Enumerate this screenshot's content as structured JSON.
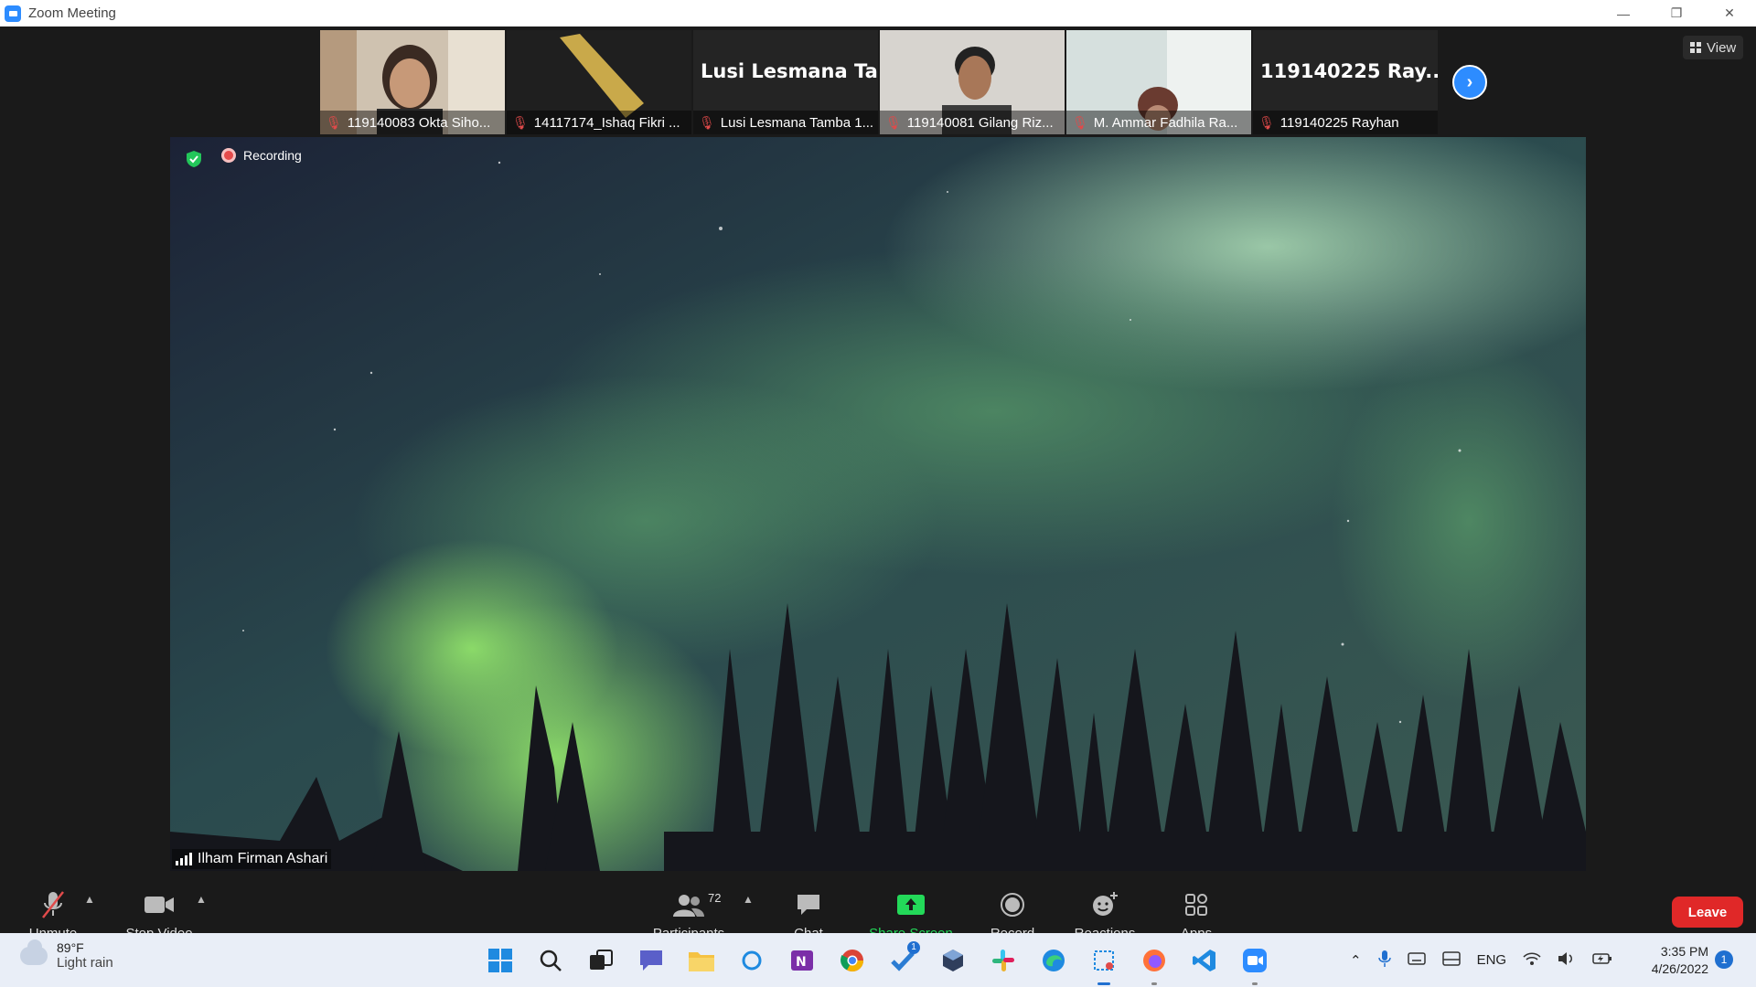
{
  "window": {
    "title": "Zoom Meeting"
  },
  "thumbnails": [
    {
      "name": "119140083 Okta Siho...",
      "type": "video",
      "muted": true,
      "icon": "mic-muted-icon"
    },
    {
      "name": "14117174_Ishaq Fikri ...",
      "type": "avatar-image",
      "muted": true,
      "icon": "mic-muted-icon"
    },
    {
      "name": "Lusi Lesmana Tamba 1...",
      "display_name": "Lusi Lesmana Ta...",
      "type": "name-only",
      "muted": true,
      "icon": "mic-muted-icon"
    },
    {
      "name": "119140081 Gilang Riz...",
      "type": "video",
      "muted": true,
      "icon": "mic-muted-icon"
    },
    {
      "name": "M. Ammar Fadhila Ra...",
      "type": "video",
      "muted": true,
      "icon": "mic-muted-icon"
    },
    {
      "name": "119140225 Rayhan",
      "display_name": "119140225  Ray...",
      "type": "name-only",
      "muted": true,
      "icon": "mic-muted-icon"
    }
  ],
  "view_button": {
    "label": "View",
    "icon": "grid-icon"
  },
  "main_video": {
    "recording_label": "Recording",
    "speaker_name": "Ilham Firman Ashari"
  },
  "toolbar": {
    "unmute": {
      "label": "Unmute",
      "icon": "mic-muted-icon"
    },
    "stop_video": {
      "label": "Stop Video",
      "icon": "video-camera-icon"
    },
    "participants": {
      "label": "Participants",
      "count": "72",
      "icon": "participants-icon"
    },
    "chat": {
      "label": "Chat",
      "icon": "chat-icon"
    },
    "share_screen": {
      "label": "Share Screen",
      "icon": "share-screen-icon",
      "color": "#23d959"
    },
    "record": {
      "label": "Record",
      "icon": "record-icon"
    },
    "reactions": {
      "label": "Reactions",
      "icon": "reactions-icon"
    },
    "apps": {
      "label": "Apps",
      "icon": "apps-icon"
    },
    "leave": {
      "label": "Leave",
      "color": "#e02828"
    }
  },
  "taskbar": {
    "weather": {
      "temp": "89°F",
      "condition": "Light rain"
    },
    "apps": [
      "windows-start-icon",
      "search-icon",
      "task-view-icon",
      "teams-chat-icon",
      "file-explorer-icon",
      "cortana-icon",
      "onenote-icon",
      "chrome-icon",
      "todo-icon",
      "virtualbox-icon",
      "slack-icon",
      "edge-icon",
      "snipping-tool-icon",
      "firefox-icon",
      "vscode-icon",
      "zoom-icon"
    ],
    "todo_badge": "1",
    "tray": {
      "language": "ENG"
    },
    "clock": {
      "time": "3:35 PM",
      "date": "4/26/2022"
    },
    "notification_count": "1"
  },
  "colors": {
    "zoom_blue": "#2D8CFF",
    "muted_red": "#e04a4a",
    "recording_red": "#e44b4b",
    "background": "#1a1a1a"
  }
}
